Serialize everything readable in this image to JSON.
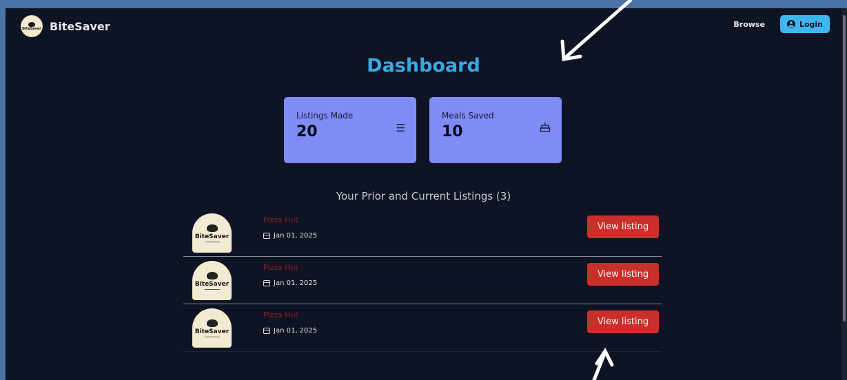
{
  "nav": {
    "brand": "BiteSaver",
    "logo_text": "BiteSaver",
    "browse": "Browse",
    "login": "Login"
  },
  "page": {
    "title": "Dashboard"
  },
  "stats": [
    {
      "label": "Listings Made",
      "value": "20",
      "icon": "list-icon"
    },
    {
      "label": "Meals Saved",
      "value": "10",
      "icon": "cake-icon"
    }
  ],
  "listings": {
    "heading": "Your Prior and Current Listings (3)",
    "items": [
      {
        "restaurant": "Pizza Hut",
        "date": "Jan 01, 2025",
        "button": "View listing"
      },
      {
        "restaurant": "Pizza Hut",
        "date": "Jan 01, 2025",
        "button": "View listing"
      },
      {
        "restaurant": "Pizza Hut",
        "date": "Jan 01, 2025",
        "button": "View listing"
      }
    ]
  },
  "colors": {
    "background": "#0f1424",
    "title": "#36a9e6",
    "card": "#7f8cf6",
    "button": "#c9302c",
    "login": "#3fb7ee",
    "frame": "#4a73a8"
  }
}
